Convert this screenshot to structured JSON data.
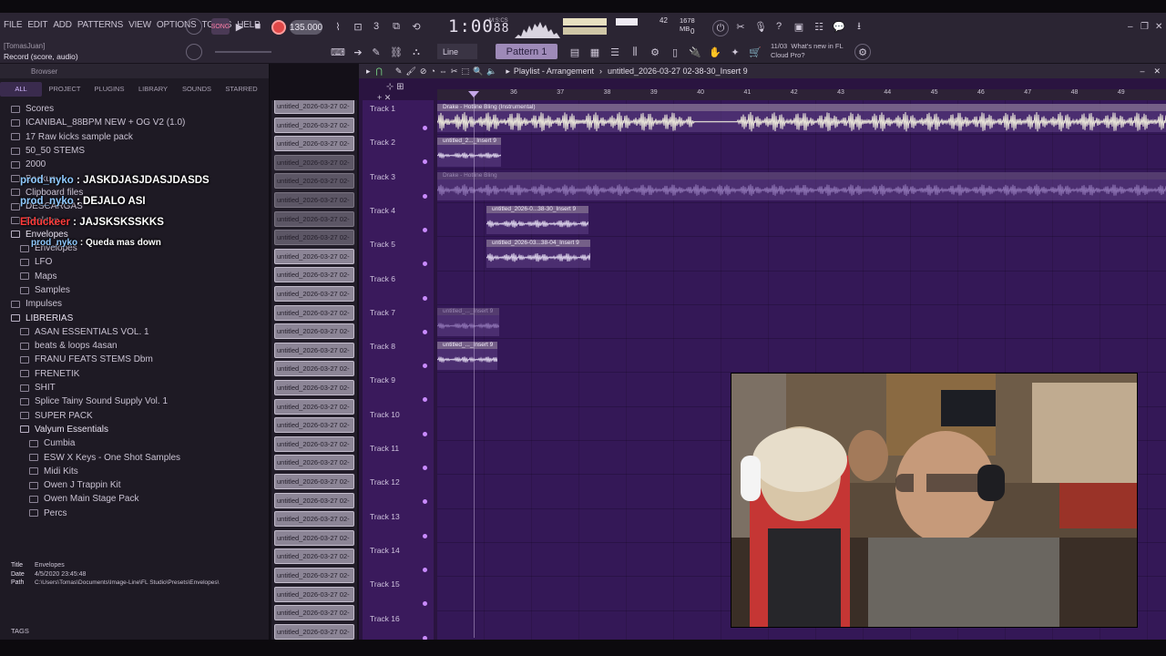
{
  "menu": [
    "FILE",
    "EDIT",
    "ADD",
    "PATTERNS",
    "VIEW",
    "OPTIONS",
    "TOOLS",
    "HELP"
  ],
  "hint": {
    "name": "[TomasJuan]",
    "text": "Record  (score, audio)"
  },
  "transport": {
    "tempo": "135.000",
    "time": "1:00",
    "time_fraction": "88",
    "time_unit": "M:S:CS",
    "cpu": "42",
    "memory": "1678 MB",
    "zero": "0",
    "snap": "Line",
    "pattern": "Pattern 1"
  },
  "news": {
    "date": "11/03",
    "line1": "What's new in FL",
    "line2": "Cloud Pro?"
  },
  "browser": {
    "title": "Browser",
    "tabs": [
      "ALL",
      "PROJECT",
      "PLUGINS",
      "LIBRARY",
      "SOUNDS",
      "STARRED"
    ],
    "items": [
      {
        "label": "Scores",
        "indent": 0,
        "open": false
      },
      {
        "label": "ICANIBAL_88BPM NEW + OG V2 (1.0)",
        "indent": 0,
        "open": false
      },
      {
        "label": "17 Raw kicks sample pack",
        "indent": 0,
        "open": false
      },
      {
        "label": "50_50 STEMS",
        "indent": 0,
        "open": false
      },
      {
        "label": "2000",
        "indent": 0,
        "open": false
      },
      {
        "label": "Backup",
        "indent": 0,
        "open": false
      },
      {
        "label": "Clipboard files",
        "indent": 0,
        "open": false
      },
      {
        "label": "DESCARGAS",
        "indent": 0,
        "open": false
      },
      {
        "label": "Desktop",
        "indent": 0,
        "open": false
      },
      {
        "label": "Envelopes",
        "indent": 0,
        "open": true
      },
      {
        "label": "Envelopes",
        "indent": 1,
        "open": false
      },
      {
        "label": "LFO",
        "indent": 1,
        "open": false
      },
      {
        "label": "Maps",
        "indent": 1,
        "open": false
      },
      {
        "label": "Samples",
        "indent": 1,
        "open": false
      },
      {
        "label": "Impulses",
        "indent": 0,
        "open": false
      },
      {
        "label": "LIBRERIAS",
        "indent": 0,
        "open": true
      },
      {
        "label": "ASAN ESSENTIALS VOL. 1",
        "indent": 1,
        "open": false
      },
      {
        "label": "beats & loops 4asan",
        "indent": 1,
        "open": false
      },
      {
        "label": "FRANU FEATS STEMS Dbm",
        "indent": 1,
        "open": false
      },
      {
        "label": "FRENETIK",
        "indent": 1,
        "open": false
      },
      {
        "label": "SHIT",
        "indent": 1,
        "open": false
      },
      {
        "label": "Splice Tainy Sound Supply Vol. 1",
        "indent": 1,
        "open": false
      },
      {
        "label": "SUPER PACK",
        "indent": 1,
        "open": false
      },
      {
        "label": "Valyum Essentials",
        "indent": 1,
        "open": true
      },
      {
        "label": "Cumbia",
        "indent": 2,
        "open": false
      },
      {
        "label": "ESW X Keys - One Shot Samples",
        "indent": 2,
        "open": false
      },
      {
        "label": "Midi Kits",
        "indent": 2,
        "open": false
      },
      {
        "label": "Owen J Trappin Kit",
        "indent": 2,
        "open": false
      },
      {
        "label": "Owen Main Stage Pack",
        "indent": 2,
        "open": false
      },
      {
        "label": "Percs",
        "indent": 2,
        "open": false
      }
    ],
    "info": {
      "title_label": "Title",
      "title": "Envelopes",
      "date_label": "Date",
      "date": "4/5/2020 23:45:48",
      "path_label": "Path",
      "path": "C:\\Users\\Tomas\\Documents\\Image-Line\\FL Studio\\Presets\\Envelopes\\"
    },
    "tags": "TAGS"
  },
  "chat": [
    {
      "user": "prod_nyko",
      "msg": "JASKDJASJDASJDASDS",
      "color": "#8fc9ff"
    },
    {
      "user": "prod_nyko",
      "msg": "DEJALO ASI",
      "color": "#8fc9ff"
    },
    {
      "user": "Elduckeer",
      "msg": "JAJSKSKSSKKS",
      "color": "#ff3b3b"
    },
    {
      "user": "prod_nyko",
      "msg": "Queda mas down",
      "color": "#8fc9ff"
    }
  ],
  "channel_clip_label": "untitled_2026-03-27 02-",
  "playlist": {
    "title": "Playlist - Arrangement",
    "project": "untitled_2026-03-27 02-38-30_Insert 9",
    "bars": [
      "36",
      "37",
      "38",
      "39",
      "40",
      "41",
      "42",
      "43",
      "44",
      "45",
      "46",
      "47",
      "48",
      "49"
    ],
    "tracks": [
      "Track 1",
      "Track 2",
      "Track 3",
      "Track 4",
      "Track 5",
      "Track 6",
      "Track 7",
      "Track 8",
      "Track 9",
      "Track 10",
      "Track 11",
      "Track 12",
      "Track 13",
      "Track 14",
      "Track 15",
      "Track 16"
    ],
    "clips": [
      {
        "label": "Drake - Hotline Bling (Instrumental)",
        "track": 0,
        "dim": false
      },
      {
        "label": "untitled_2..._Insert 9",
        "track": 1,
        "dim": false
      },
      {
        "label": "Drake - Hotline Bling",
        "track": 2,
        "dim": true
      },
      {
        "label": "untitled_2026-0...38-30_Insert 9",
        "track": 3,
        "dim": false
      },
      {
        "label": "untitled_2026-03...38-04_Insert 9",
        "track": 4,
        "dim": false
      },
      {
        "label": "untitled_..._Insert 9",
        "track": 6,
        "dim": true
      },
      {
        "label": "untitled_..._Insert 9",
        "track": 7,
        "dim": false
      }
    ]
  }
}
